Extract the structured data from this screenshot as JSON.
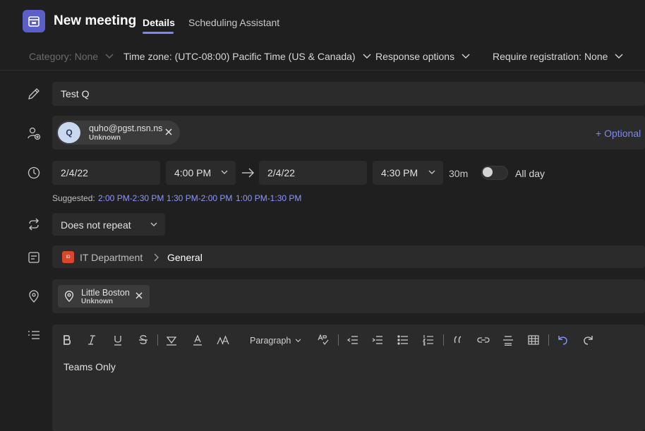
{
  "header": {
    "title": "New meeting",
    "tabs": [
      {
        "label": "Details",
        "active": true
      },
      {
        "label": "Scheduling Assistant",
        "active": false
      }
    ],
    "accent": "#7f85f5",
    "app_icon": "calendar-icon"
  },
  "options": {
    "category": "Category: None",
    "timezone": "Time zone: (UTC-08:00) Pacific Time (US & Canada)",
    "response": "Response options",
    "registration": "Require registration: None"
  },
  "meeting": {
    "title": "Test Q",
    "attendee": {
      "initial": "Q",
      "email": "quho@pgst.nsn.ns",
      "status": "Unknown"
    },
    "optional_label": "+ Optional",
    "start_date": "2/4/22",
    "start_time": "4:00 PM",
    "end_date": "2/4/22",
    "end_time": "4:30 PM",
    "duration": "30m",
    "all_day_label": "All day",
    "all_day": false,
    "suggested_label": "Suggested:",
    "suggestions": [
      "2:00 PM-2:30 PM",
      "1:30 PM-2:00 PM",
      "1:00 PM-1:30 PM"
    ],
    "repeat": "Does not repeat",
    "team_badge": "ID",
    "team": "IT Department",
    "channel": "General",
    "location": {
      "name": "Little Boston",
      "status": "Unknown"
    }
  },
  "editor": {
    "paragraph_style": "Paragraph",
    "body": "Teams Only",
    "tools": [
      "bold-icon",
      "italic-icon",
      "underline-icon",
      "strikethrough-icon",
      "highlight-icon",
      "font-color-icon",
      "font-size-icon",
      "paragraph-select",
      "format-painter-icon",
      "decrease-indent-icon",
      "increase-indent-icon",
      "bulleted-list-icon",
      "numbered-list-icon",
      "quote-icon",
      "link-icon",
      "horizontal-rule-icon",
      "table-icon",
      "undo-icon",
      "redo-icon"
    ]
  }
}
